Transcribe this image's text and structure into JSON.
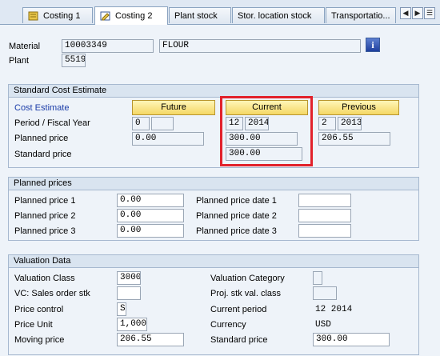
{
  "tabs": [
    {
      "label": "Costing 1",
      "active": false
    },
    {
      "label": "Costing 2",
      "active": true
    },
    {
      "label": "Plant stock",
      "active": false
    },
    {
      "label": "Stor. location stock",
      "active": false
    },
    {
      "label": "Transportatio...",
      "active": false
    }
  ],
  "tab_nav": {
    "prev": "◀",
    "next": "▶",
    "list": "☰"
  },
  "header": {
    "material_label": "Material",
    "material_value": "10003349",
    "material_desc": "FLOUR",
    "plant_label": "Plant",
    "plant_value": "5519",
    "info_button": "i"
  },
  "std_cost": {
    "title": "Standard Cost Estimate",
    "cost_estimate_label": "Cost Estimate",
    "future_btn": "Future",
    "current_btn": "Current",
    "previous_btn": "Previous",
    "period_label": "Period / Fiscal Year",
    "planned_price_label": "Planned price",
    "standard_price_label": "Standard price",
    "future": {
      "period": "0",
      "year": "",
      "planned": "0.00"
    },
    "current": {
      "period": "12",
      "year": "2014",
      "planned": "300.00",
      "standard": "300.00"
    },
    "previous": {
      "period": "2",
      "year": "2013",
      "planned": "206.55"
    }
  },
  "planned_prices": {
    "title": "Planned prices",
    "pp1_label": "Planned price 1",
    "pp1_value": "0.00",
    "pp2_label": "Planned price 2",
    "pp2_value": "0.00",
    "pp3_label": "Planned price 3",
    "pp3_value": "0.00",
    "ppd1_label": "Planned price date 1",
    "ppd1_value": "",
    "ppd2_label": "Planned price date 2",
    "ppd2_value": "",
    "ppd3_label": "Planned price date 3",
    "ppd3_value": ""
  },
  "valuation": {
    "title": "Valuation Data",
    "val_class_label": "Valuation Class",
    "val_class_value": "3000",
    "vc_sales_label": "VC: Sales order stk",
    "vc_sales_value": "",
    "price_control_label": "Price control",
    "price_control_value": "S",
    "price_unit_label": "Price Unit",
    "price_unit_value": "1,000",
    "moving_price_label": "Moving price",
    "moving_price_value": "206.55",
    "val_cat_label": "Valuation Category",
    "val_cat_value": "",
    "proj_stk_label": "Proj. stk val. class",
    "proj_stk_value": "",
    "current_period_label": "Current period",
    "current_period_value": "12 2014",
    "currency_label": "Currency",
    "currency_value": "USD",
    "standard_price_label": "Standard price",
    "standard_price_value": "300.00"
  },
  "colors": {
    "highlight": "#e2212b",
    "link": "#1a3ca8",
    "button_yellow": "#f4d765"
  }
}
